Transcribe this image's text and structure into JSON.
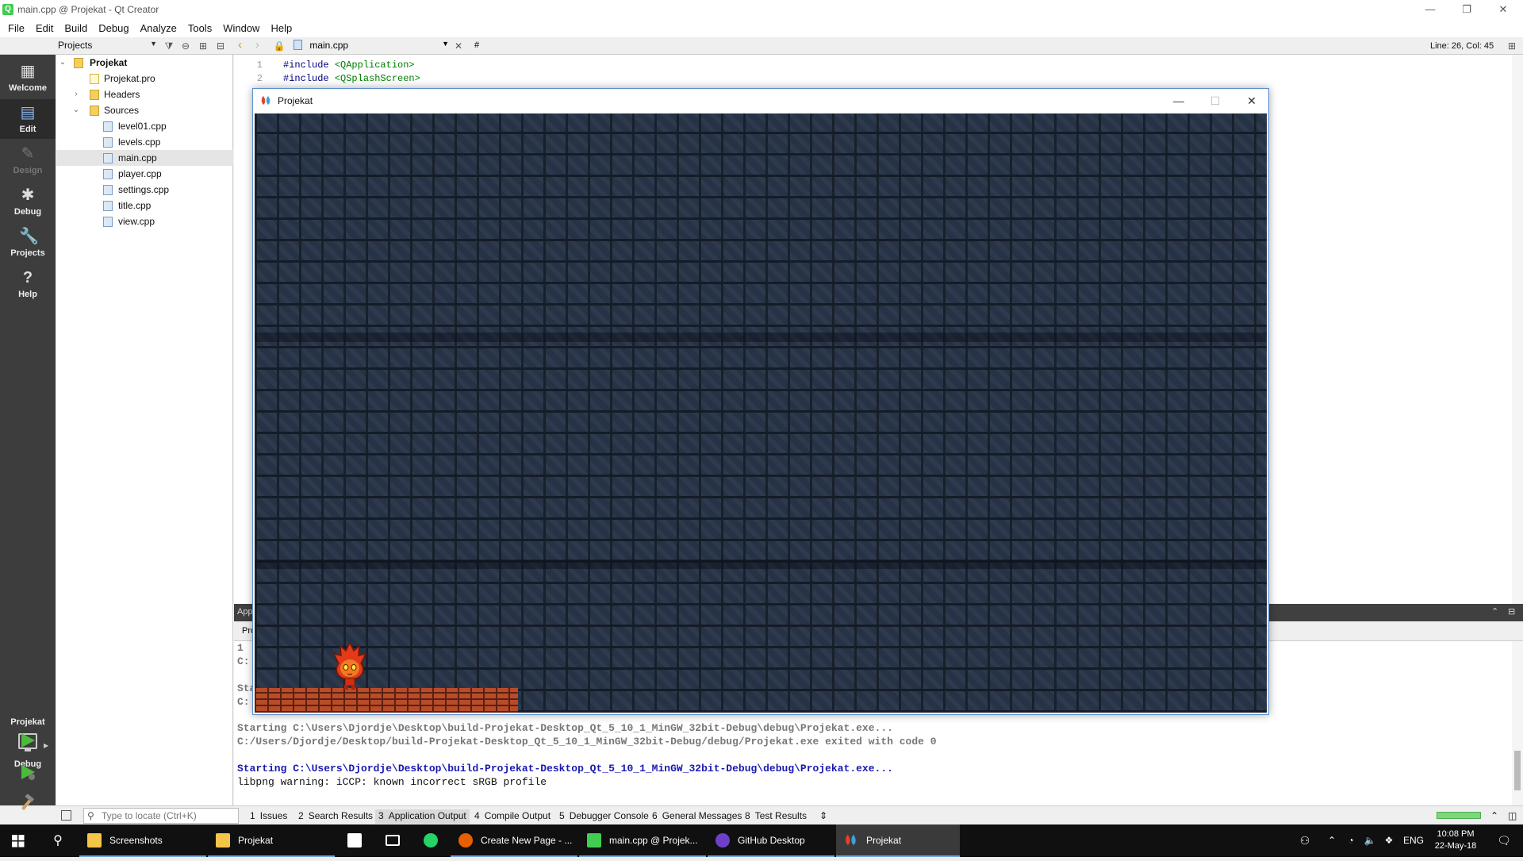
{
  "window": {
    "title": "main.cpp @ Projekat - Qt Creator"
  },
  "menu": [
    "File",
    "Edit",
    "Build",
    "Debug",
    "Analyze",
    "Tools",
    "Window",
    "Help"
  ],
  "toolbar": {
    "projects_combo": "Projects",
    "open_file": "main.cpp",
    "symbol": "#",
    "line_col": "Line: 26, Col: 45"
  },
  "modes": [
    {
      "label": "Welcome",
      "icon": "grid-icon",
      "state": "normal"
    },
    {
      "label": "Edit",
      "icon": "document-icon",
      "state": "active"
    },
    {
      "label": "Design",
      "icon": "pencil-icon",
      "state": "disabled"
    },
    {
      "label": "Debug",
      "icon": "bug-icon",
      "state": "normal"
    },
    {
      "label": "Projects",
      "icon": "wrench-icon",
      "state": "normal"
    },
    {
      "label": "Help",
      "icon": "help-icon",
      "state": "normal"
    }
  ],
  "kit": {
    "project": "Projekat",
    "build": "Debug"
  },
  "tree": {
    "root": "Projekat",
    "pro_file": "Projekat.pro",
    "headers": "Headers",
    "sources": "Sources",
    "files": [
      "level01.cpp",
      "levels.cpp",
      "main.cpp",
      "player.cpp",
      "settings.cpp",
      "title.cpp",
      "view.cpp"
    ],
    "selected": "main.cpp"
  },
  "editor": {
    "lines": [
      {
        "n": "1",
        "directive": "#include",
        "header": "<QApplication>"
      },
      {
        "n": "2",
        "directive": "#include",
        "header": "<QSplashScreen>"
      }
    ]
  },
  "output": {
    "header": "App",
    "sub": "Pro",
    "partial_lines": [
      "1",
      "C:",
      "Sta",
      "C:"
    ],
    "lines": [
      {
        "text": "Starting C:\\Users\\Djordje\\Desktop\\build-Projekat-Desktop_Qt_5_10_1_MinGW_32bit-Debug\\debug\\Projekat.exe...",
        "style": "gray"
      },
      {
        "text": "C:/Users/Djordje/Desktop/build-Projekat-Desktop_Qt_5_10_1_MinGW_32bit-Debug/debug/Projekat.exe exited with code 0",
        "style": "gray"
      },
      {
        "text": "Starting C:\\Users\\Djordje\\Desktop\\build-Projekat-Desktop_Qt_5_10_1_MinGW_32bit-Debug\\debug\\Projekat.exe...",
        "style": "blue"
      },
      {
        "text": "libpng warning: iCCP: known incorrect sRGB profile",
        "style": "black"
      }
    ]
  },
  "statusbar": {
    "locate_placeholder": "Type to locate (Ctrl+K)",
    "tabs": [
      {
        "num": "1",
        "label": "Issues"
      },
      {
        "num": "2",
        "label": "Search Results"
      },
      {
        "num": "3",
        "label": "Application Output",
        "active": true
      },
      {
        "num": "4",
        "label": "Compile Output"
      },
      {
        "num": "5",
        "label": "Debugger Console"
      },
      {
        "num": "6",
        "label": "General Messages"
      },
      {
        "num": "8",
        "label": "Test Results"
      }
    ]
  },
  "game_window": {
    "title": "Projekat"
  },
  "taskbar": {
    "items": [
      {
        "label": "Screenshots",
        "icon": "folder-icon",
        "color": "#f3c64a"
      },
      {
        "label": "Projekat",
        "icon": "folder-icon",
        "color": "#f3c64a"
      },
      {
        "label": "",
        "icon": "store-icon",
        "color": "#ffffff"
      },
      {
        "label": "",
        "icon": "mail-icon",
        "color": "#ffffff"
      },
      {
        "label": "",
        "icon": "whatsapp-icon",
        "color": "#25d366"
      },
      {
        "label": "Create New Page - ...",
        "icon": "firefox-icon",
        "color": "#e66000"
      },
      {
        "label": "main.cpp @ Projek...",
        "icon": "qt-icon",
        "color": "#41cd52"
      },
      {
        "label": "GitHub Desktop",
        "icon": "github-icon",
        "color": "#6e40c9"
      },
      {
        "label": "Projekat",
        "icon": "game-icon",
        "color": "#d03020"
      }
    ],
    "language": "ENG",
    "time": "10:08 PM",
    "date": "22-May-18"
  }
}
